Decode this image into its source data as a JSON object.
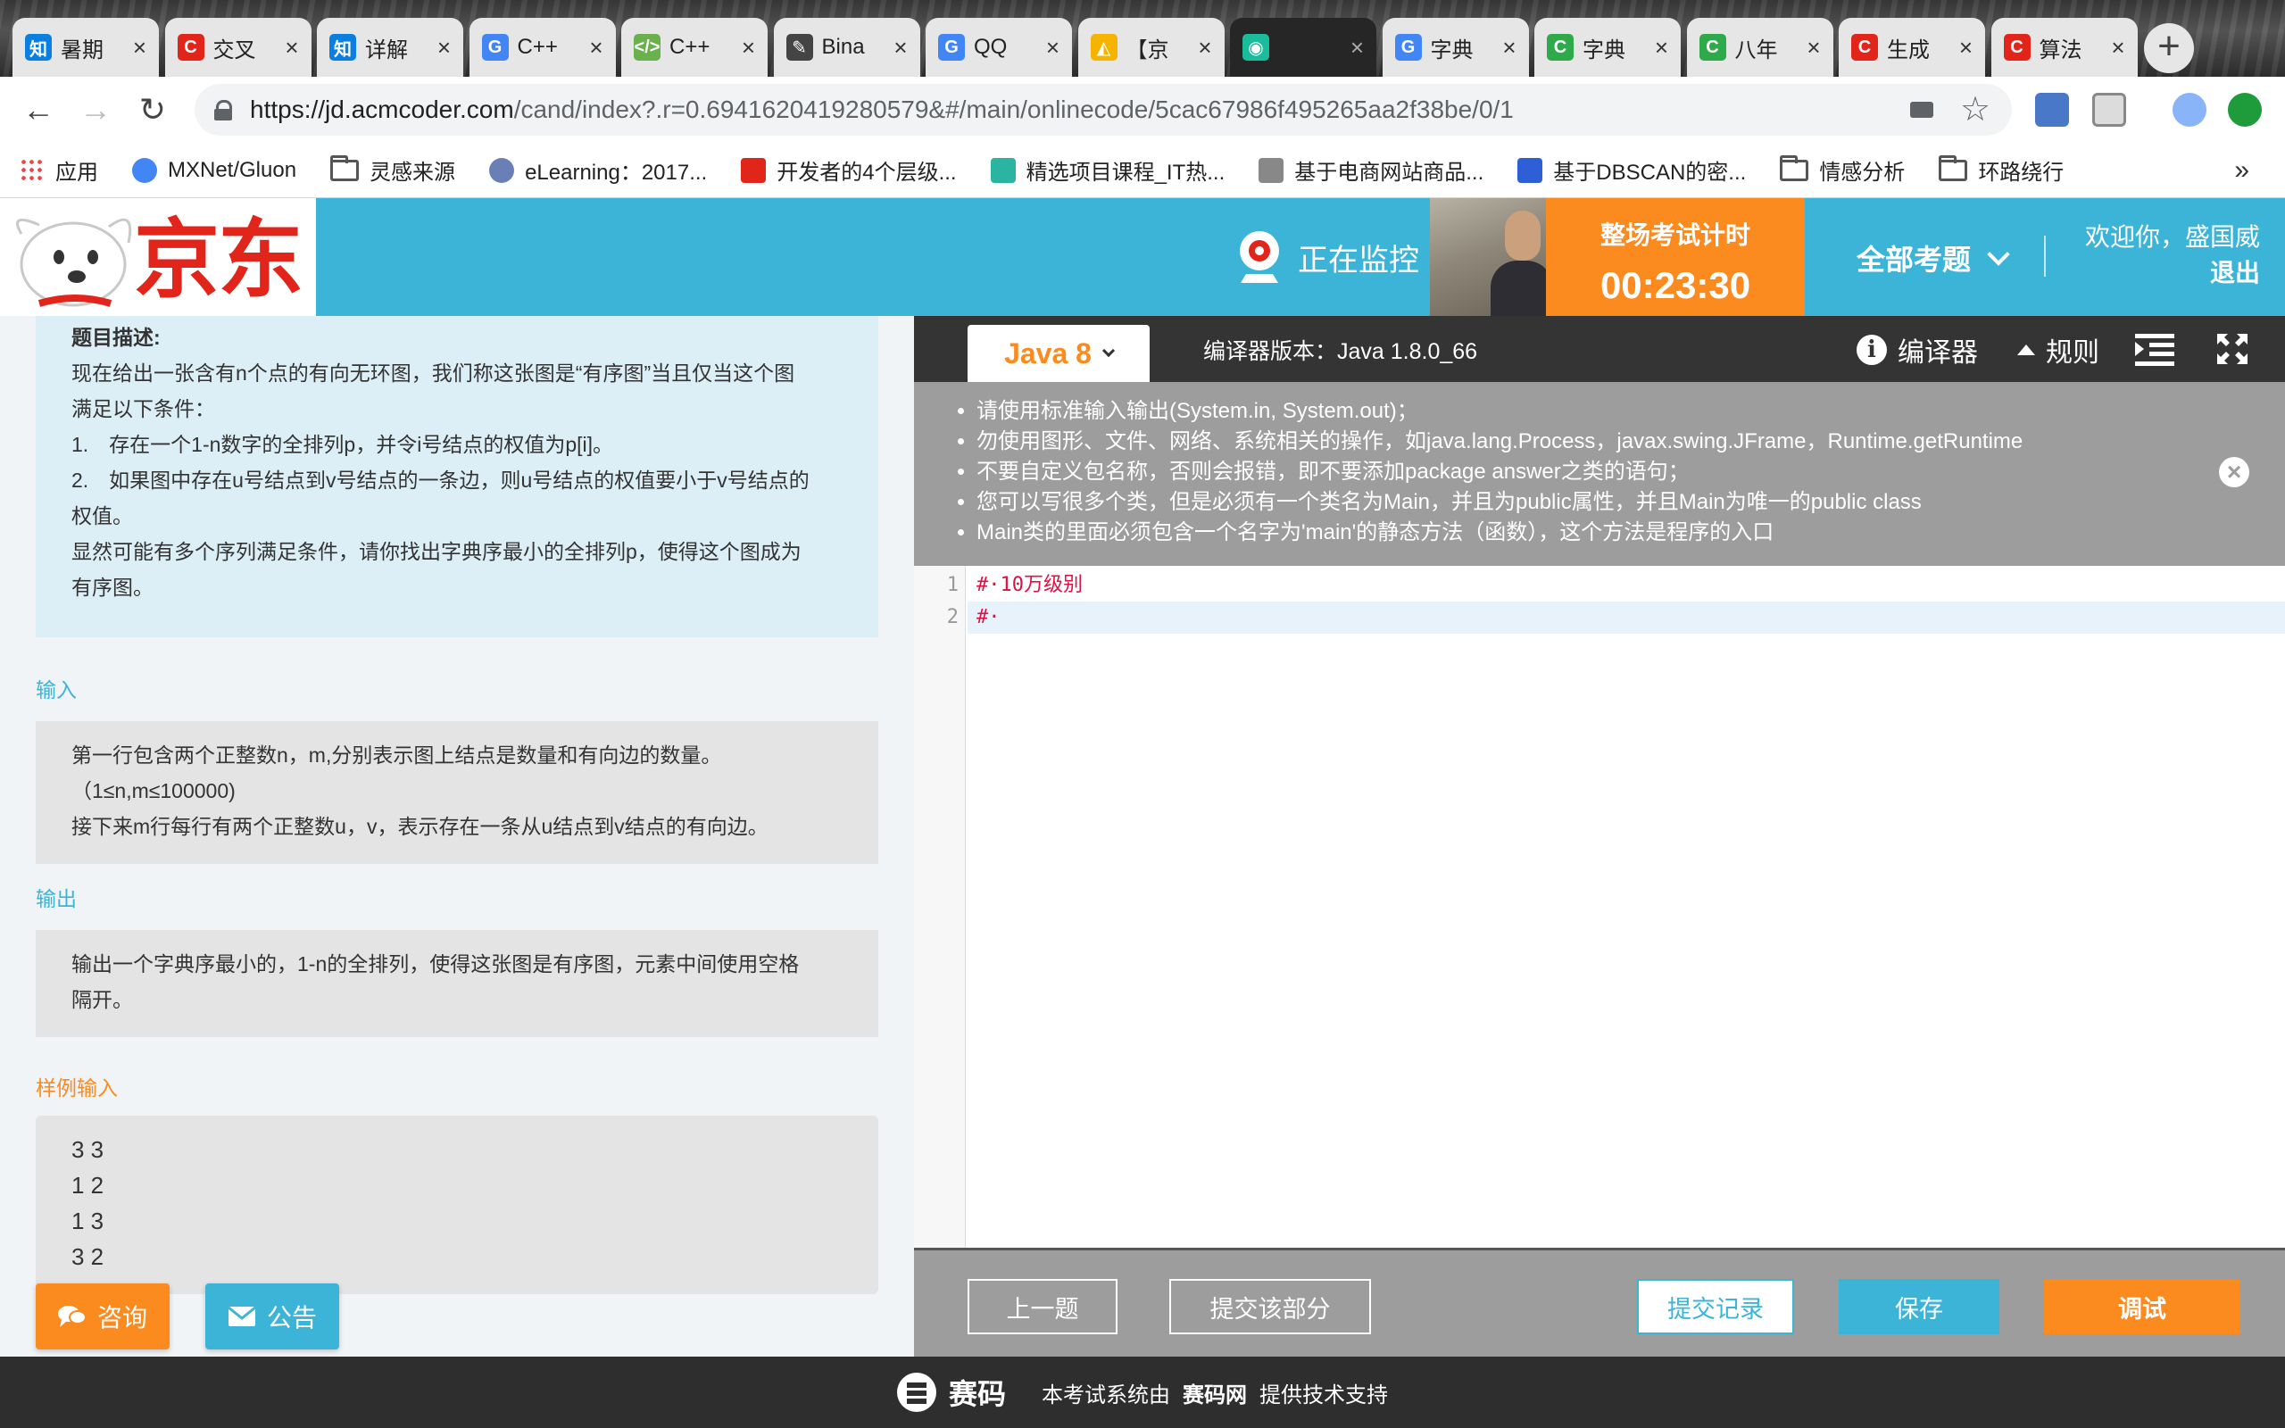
{
  "browser": {
    "tabs": [
      {
        "title": "暑期",
        "icon": "zhihu-icon",
        "fav_text": "知",
        "fav_color": "#0a7fe0"
      },
      {
        "title": "交叉",
        "icon": "csdn-icon",
        "fav_text": "C",
        "fav_color": "#e1251b"
      },
      {
        "title": "详解",
        "icon": "zhihu-icon",
        "fav_text": "知",
        "fav_color": "#0a7fe0"
      },
      {
        "title": "C++",
        "icon": "google-icon",
        "fav_text": "G",
        "fav_color": "#4285f4"
      },
      {
        "title": "C++",
        "icon": "code-icon",
        "fav_text": "</>",
        "fav_color": "#6ab04c"
      },
      {
        "title": "Bina",
        "icon": "binary-icon",
        "fav_text": "✎",
        "fav_color": "#444444"
      },
      {
        "title": "QQ",
        "icon": "google-icon",
        "fav_text": "G",
        "fav_color": "#4285f4"
      },
      {
        "title": "【京",
        "icon": "drive-icon",
        "fav_text": "◭",
        "fav_color": "#f4b400"
      },
      {
        "title": "",
        "icon": "recording-icon",
        "fav_text": "◉",
        "fav_color": "#1abc9c"
      },
      {
        "title": "字典",
        "icon": "google-icon",
        "fav_text": "G",
        "fav_color": "#4285f4"
      },
      {
        "title": "字典",
        "icon": "c-icon",
        "fav_text": "C",
        "fav_color": "#2eaa4a"
      },
      {
        "title": "八年",
        "icon": "c-icon",
        "fav_text": "C",
        "fav_color": "#2eaa4a"
      },
      {
        "title": "生成",
        "icon": "csdn-icon",
        "fav_text": "C",
        "fav_color": "#e1251b"
      },
      {
        "title": "算法",
        "icon": "csdn-icon",
        "fav_text": "C",
        "fav_color": "#e1251b"
      }
    ],
    "url_host": "https://jd.acmcoder.com",
    "url_rest": "/cand/index?.r=0.6941620419280579&#/main/onlinecode/5cac67986f495265aa2f38be/0/1",
    "bookmarks": [
      {
        "label": "应用",
        "icon": "apps-grid-icon"
      },
      {
        "label": "MXNet/Gluon",
        "icon": "google-icon"
      },
      {
        "label": "灵感来源",
        "icon": "folder-icon"
      },
      {
        "label": "eLearning：2017...",
        "icon": "globe-icon"
      },
      {
        "label": "开发者的4个层级...",
        "icon": "csdn-icon"
      },
      {
        "label": "精选项目课程_IT热...",
        "icon": "feather-icon"
      },
      {
        "label": "基于电商网站商品...",
        "icon": "document-icon"
      },
      {
        "label": "基于DBSCAN的密...",
        "icon": "baidu-icon"
      },
      {
        "label": "情感分析",
        "icon": "folder-icon"
      },
      {
        "label": "环路绕行",
        "icon": "folder-icon"
      }
    ],
    "more_bookmarks": "»"
  },
  "header": {
    "logo_text": "京东",
    "monitor_label": "正在监控",
    "timer_label": "整场考试计时",
    "timer_value": "00:23:30",
    "all_questions": "全部考题",
    "welcome": "欢迎你，盛国威",
    "logout": "退出"
  },
  "problem": {
    "desc_title": "题目描述:",
    "desc_lines": [
      "现在给出一张含有n个点的有向无环图，我们称这张图是“有序图”当且仅当这个图",
      "满足以下条件：",
      "1.　存在一个1-n数字的全排列p，并令i号结点的权值为p[i]。",
      "2.　如果图中存在u号结点到v号结点的一条边，则u号结点的权值要小于v号结点的",
      "权值。",
      "显然可能有多个序列满足条件，请你找出字典序最小的全排列p，使得这个图成为",
      "有序图。"
    ],
    "input_title": "输入",
    "input_lines": [
      "第一行包含两个正整数n，m,分别表示图上结点是数量和有向边的数量。",
      "（1≤n,m≤100000)",
      "接下来m行每行有两个正整数u，v，表示存在一条从u结点到v结点的有向边。"
    ],
    "output_title": "输出",
    "output_lines": [
      "输出一个字典序最小的，1-n的全排列，使得这张图是有序图，元素中间使用空格",
      "隔开。"
    ],
    "sample_input_title": "样例输入",
    "sample_input_lines": [
      "3 3",
      "1 2",
      "1 3",
      "3 2"
    ]
  },
  "float_buttons": {
    "consult": "咨询",
    "notice": "公告"
  },
  "editor": {
    "language": "Java 8",
    "compiler_version": "编译器版本：Java 1.8.0_66",
    "compiler_label": "编译器",
    "rules_label": "规则",
    "notices": [
      "请使用标准输入输出(System.in, System.out)；",
      "勿使用图形、文件、网络、系统相关的操作，如java.lang.Process，javax.swing.JFrame，Runtime.getRuntime",
      "不要自定义包名称，否则会报错，即不要添加package answer之类的语句；",
      "您可以写很多个类，但是必须有一个类名为Main，并且为public属性，并且Main为唯一的public class",
      "Main类的里面必须包含一个名字为'main'的静态方法（函数），这个方法是程序的入口"
    ],
    "code_lines": [
      {
        "no": "1",
        "text": "#·10万级别"
      },
      {
        "no": "2",
        "text": "#·"
      }
    ],
    "buttons": {
      "prev": "上一题",
      "submit_part": "提交该部分",
      "history": "提交记录",
      "save": "保存",
      "debug": "调试"
    }
  },
  "footer": {
    "brand": "赛码",
    "text_before": "本考试系统由",
    "text_bold": "赛码网",
    "text_after": "提供技术支持"
  },
  "colors": {
    "accent_blue": "#3bb4d8",
    "accent_orange": "#fb8a1f",
    "jd_red": "#e1251b"
  }
}
